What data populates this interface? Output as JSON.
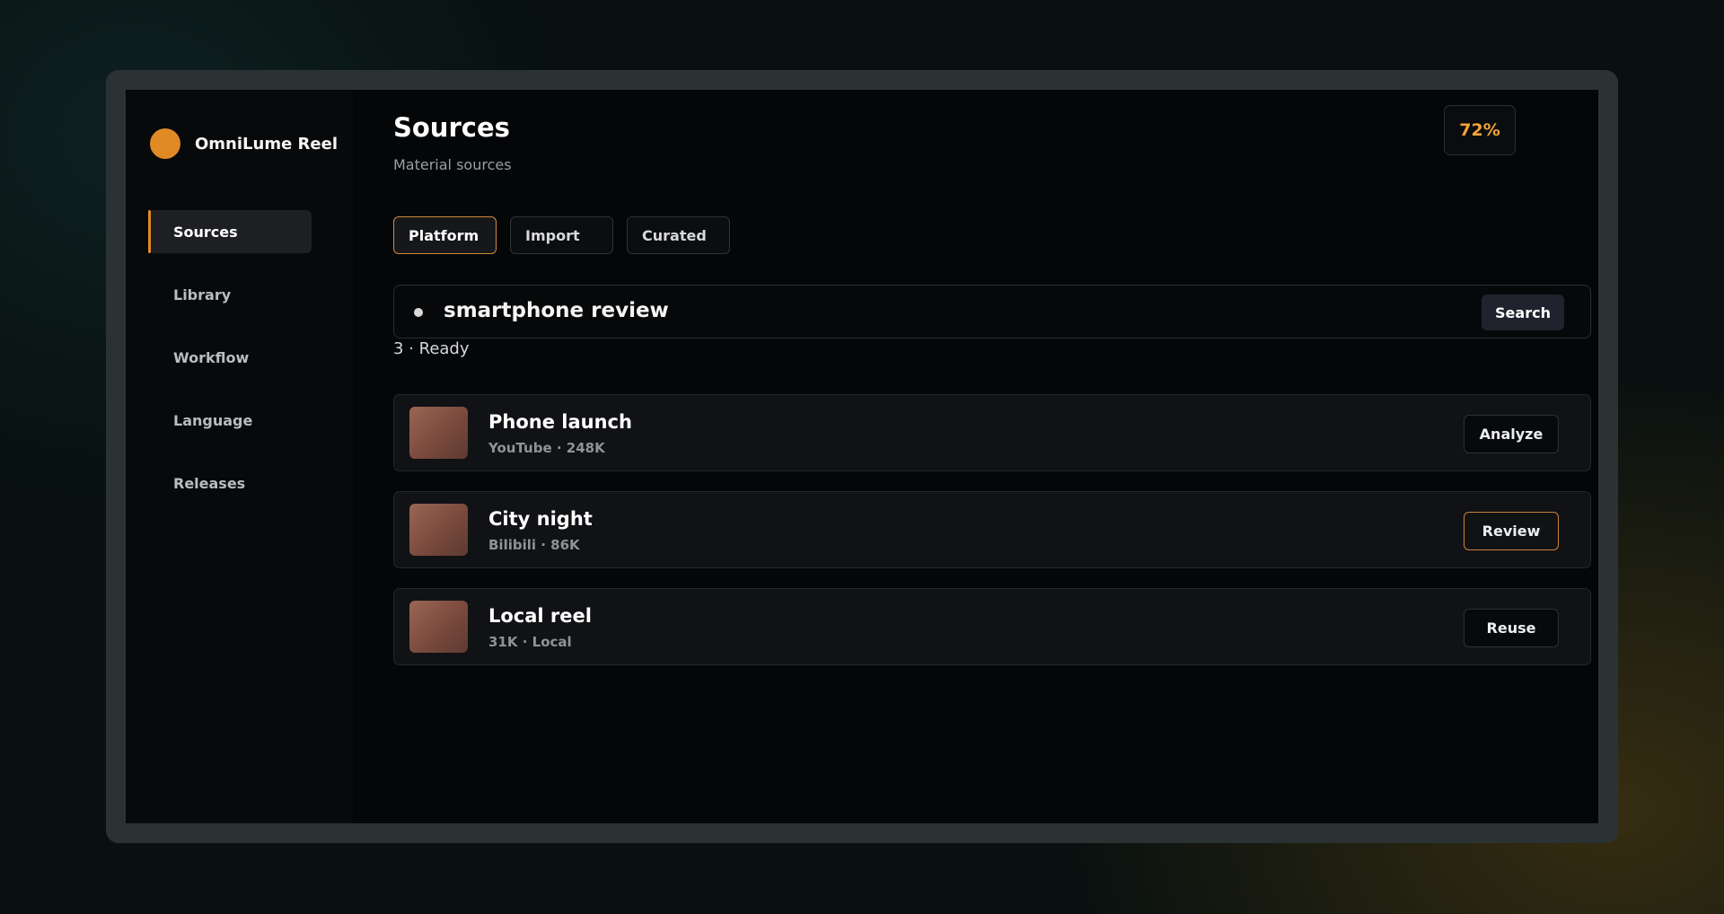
{
  "app": {
    "name": "OmniLume Reel",
    "accent_color": "#e08a26"
  },
  "sidebar": {
    "items": [
      {
        "label": "Sources",
        "active": true
      },
      {
        "label": "Library",
        "active": false
      },
      {
        "label": "Workflow",
        "active": false
      },
      {
        "label": "Language",
        "active": false
      },
      {
        "label": "Releases",
        "active": false
      }
    ]
  },
  "header": {
    "title": "Sources",
    "subtitle": "Material sources",
    "progress": "72%"
  },
  "tabs": [
    {
      "label": "Platform",
      "active": true
    },
    {
      "label": "Import",
      "active": false
    },
    {
      "label": "Curated",
      "active": false
    }
  ],
  "search": {
    "value": "smartphone review",
    "button_label": "Search"
  },
  "status": {
    "text": "3 · Ready"
  },
  "results": [
    {
      "title": "Phone launch",
      "meta": "YouTube · 248K",
      "action": "Analyze",
      "highlighted": false
    },
    {
      "title": "City night",
      "meta": "Bilibili · 86K",
      "action": "Review",
      "highlighted": true
    },
    {
      "title": "Local reel",
      "meta": "31K · Local",
      "action": "Reuse",
      "highlighted": false
    }
  ]
}
